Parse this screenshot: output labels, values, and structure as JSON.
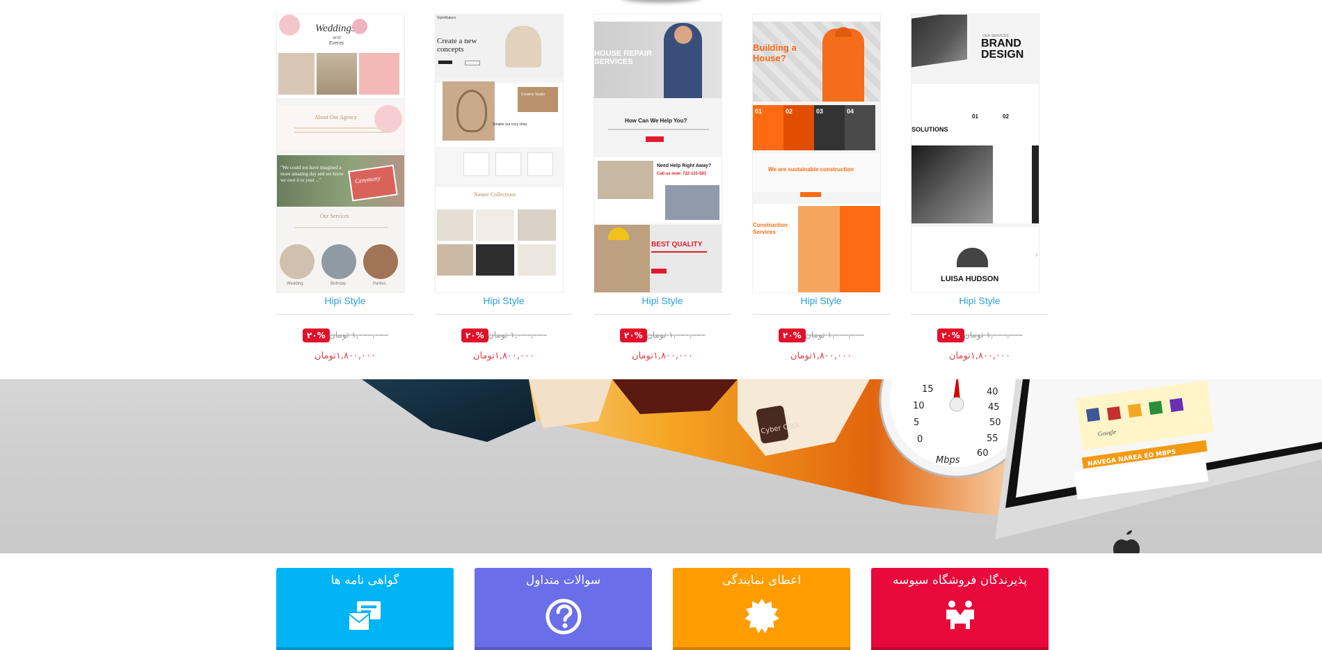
{
  "products": [
    {
      "name": "Hipi Style",
      "discount": "٢٠%",
      "old_price": "١,٠٠٠,٠٠٠ تومان",
      "new_price": "١,٨٠٠,٠٠٠تومان",
      "theme": "weddings"
    },
    {
      "name": "Hipi Style",
      "discount": "٢٠%",
      "old_price": "١,٠٠٠,٠٠٠ تومان",
      "new_price": "١,٨٠٠,٠٠٠تومان",
      "theme": "furniture"
    },
    {
      "name": "Hipi Style",
      "discount": "٢٠%",
      "old_price": "١,٠٠٠,٠٠٠ تومان",
      "new_price": "١,٨٠٠,٠٠٠تومان",
      "theme": "repair"
    },
    {
      "name": "Hipi Style",
      "discount": "٢٠%",
      "old_price": "١,٠٠٠,٠٠٠ تومان",
      "new_price": "١,٨٠٠,٠٠٠تومان",
      "theme": "construction"
    },
    {
      "name": "Hipi Style",
      "discount": "٢٠%",
      "old_price": "١,٠٠٠,٠٠٠ تومان",
      "new_price": "١,٨٠٠,٠٠٠تومان",
      "theme": "brand"
    }
  ],
  "thumb_text": {
    "weddings": {
      "title": "Weddings",
      "and": "and",
      "events": "Events",
      "about": "About Our Agency",
      "quote": "\"We could not have imagined a more amazing day and we know we owe it to your ...\"",
      "ceremony": "Ceremony",
      "services": "Our Services",
      "s1": "Wedding",
      "s2": "Birthday",
      "s3": "Parties"
    },
    "furniture": {
      "logo": "StyleMakers",
      "hero": "Create a new concepts",
      "studio": "Creative Studio",
      "simple": "Simpler but cozy shop",
      "nature": "Nature Collections"
    },
    "repair": {
      "hero": "HOUSE REPAIR SERVICES",
      "help": "How Can We Help You?",
      "need": "Need Help Right Away?",
      "call": "Call us now: 722-131-581",
      "quality": "BEST QUALITY"
    },
    "construction": {
      "hero": "Building a House?",
      "n1": "01",
      "n2": "02",
      "n3": "03",
      "n4": "04",
      "sustain": "We are sustainable construction",
      "services": "Construction Services"
    },
    "brand": {
      "kicker": "OUR SERVICES",
      "title": "BRAND DESIGN",
      "solutions": "SOLUTIONS",
      "n1": "01",
      "n2": "02",
      "person": "LUISA HUDSON"
    }
  },
  "banner": {
    "speed_labels": [
      "15",
      "10",
      "5",
      "0",
      "40",
      "45",
      "50",
      "55",
      "60"
    ],
    "speed_unit": "Mbps",
    "cup_text": "Cyber Click",
    "google_label": "Google",
    "strip_text": "NAVEGA NAREA EO MBPS"
  },
  "features": [
    {
      "title": "پذیرندگان فروشگاه سیوسه",
      "color": "#e8083a",
      "icon": "handshake-icon"
    },
    {
      "title": "اعطای نمایندگی",
      "color": "#ff9c00",
      "icon": "badge-icon"
    },
    {
      "title": "سوالات متداول",
      "color": "#6a6ee8",
      "icon": "question-icon"
    },
    {
      "title": "گواهی نامه ها",
      "color": "#00b4f5",
      "icon": "certificate-icon"
    }
  ]
}
